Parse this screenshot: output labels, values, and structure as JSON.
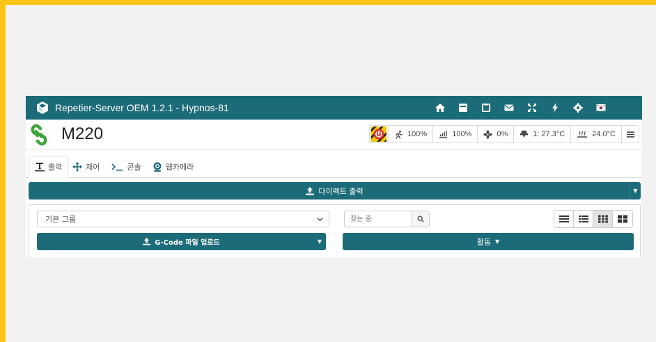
{
  "navbar": {
    "title": "Repetier-Server OEM 1.2.1 - Hypnos-81",
    "icons": [
      "home-icon",
      "printer-icon",
      "book-icon",
      "envelope-icon",
      "expand-icon",
      "bolt-icon",
      "gear-icon",
      "flag-icon"
    ]
  },
  "printer": {
    "name": "M220",
    "status": {
      "speed": "100%",
      "flow": "100%",
      "fan": "0%",
      "extruder_temp": "1: 27.3°C",
      "bed_temp": "24.0°C"
    }
  },
  "tabs": [
    {
      "label": "출력",
      "icon": "print-icon"
    },
    {
      "label": "제어",
      "icon": "move-icon"
    },
    {
      "label": "콘솔",
      "icon": "terminal-icon"
    },
    {
      "label": "웹카메라",
      "icon": "webcam-icon"
    }
  ],
  "direct_print": {
    "label": "다이렉트 출력"
  },
  "filters": {
    "group_selected": "기본 그룹",
    "search_placeholder": "찾는 중"
  },
  "upload": {
    "label": "G-Code 파일 업로드"
  },
  "activity": {
    "label": "활동"
  },
  "colors": {
    "accent": "#1c6b78",
    "frame": "#fcc419",
    "background": "#f2f2f2"
  }
}
